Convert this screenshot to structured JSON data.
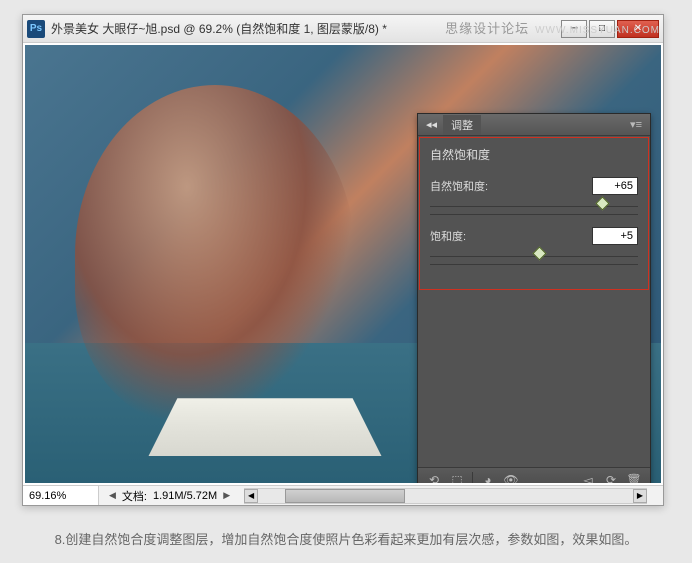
{
  "watermark": {
    "text": "思缘设计论坛",
    "site": "WWW.MISSYUAN.COM"
  },
  "window": {
    "title": "外景美女  大眼仔~旭.psd @ 69.2% (自然饱和度 1, 图层蒙版/8) *",
    "ps_abbr": "Ps"
  },
  "panel": {
    "tab_label": "调整",
    "title": "自然饱和度",
    "sliders": [
      {
        "label": "自然饱和度:",
        "value": "+65",
        "pos": 82
      },
      {
        "label": "饱和度:",
        "value": "+5",
        "pos": 52
      }
    ]
  },
  "statusbar": {
    "zoom": "69.16%",
    "doc_label": "文档:",
    "doc_size": "1.91M/5.72M"
  },
  "caption": "8.创建自然饱合度调整图层，增加自然饱合度使照片色彩看起来更加有层次感，参数如图，效果如图。"
}
